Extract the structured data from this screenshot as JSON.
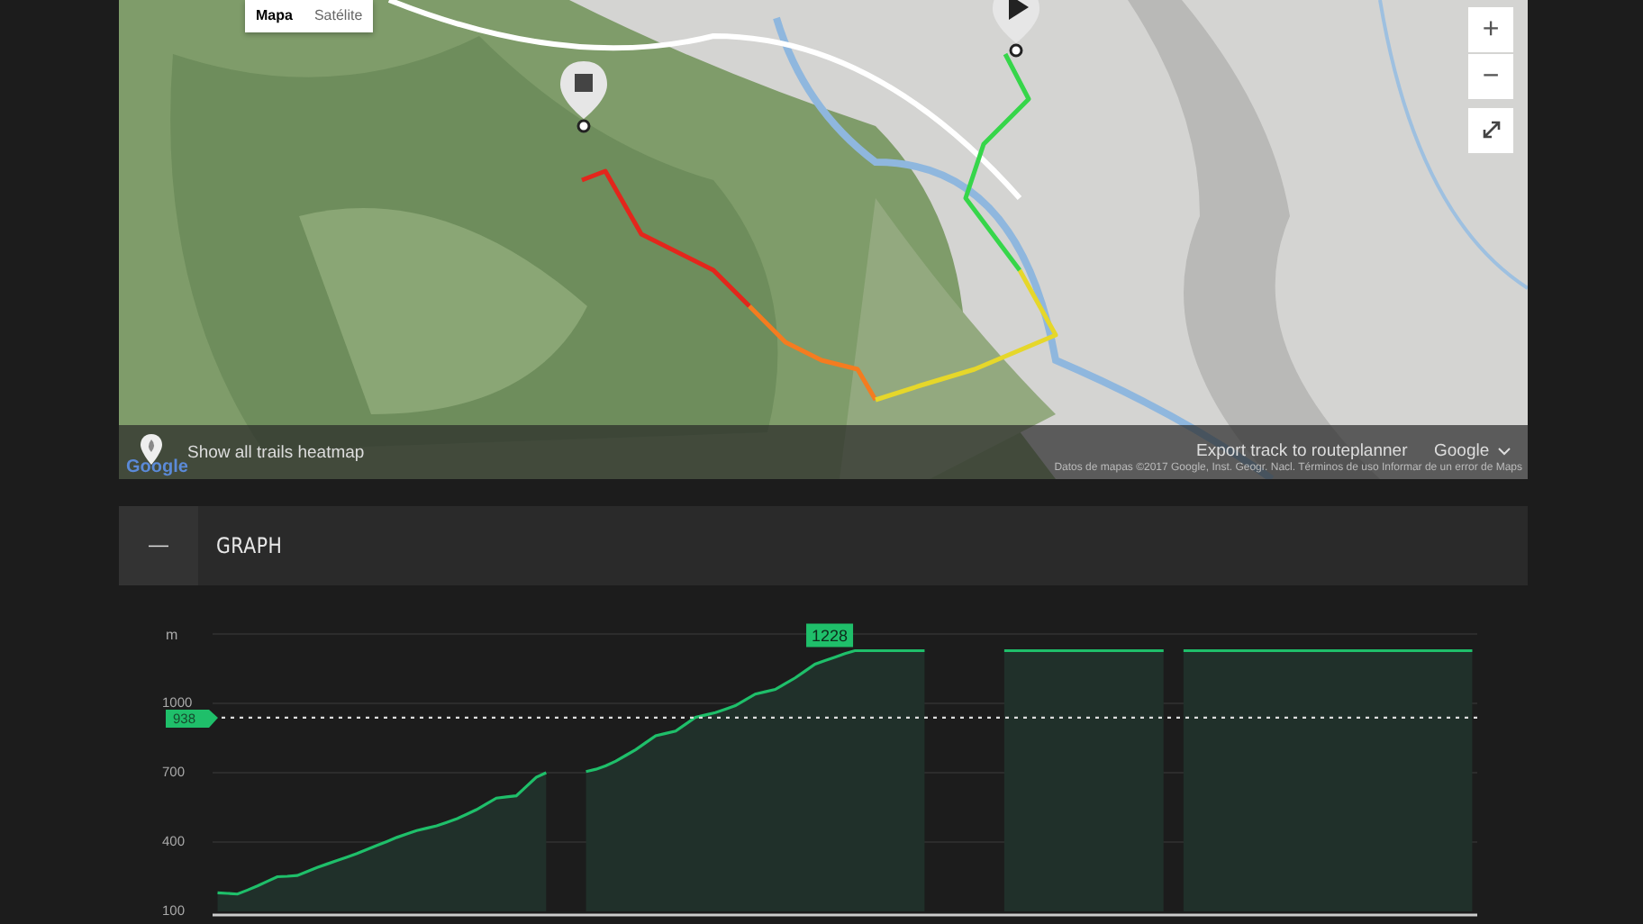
{
  "map": {
    "kind": "picture",
    "map_types": [
      {
        "label": "Mapa",
        "selected": true
      },
      {
        "label": "Satélite",
        "selected": false
      }
    ],
    "zoom_in": "+",
    "zoom_out": "−",
    "heatmap_toggle": "Show all trails heatmap",
    "logo": "Google",
    "export_link": "Export track to routeplanner",
    "language_select": "Google",
    "attribution": "Datos de mapas ©2017 Google, Inst. Geogr. Nacl. Términos de uso Informar de un error de Maps"
  },
  "graph": {
    "collapse_symbol": "—",
    "title": "GRAPH",
    "chart_data": {
      "type": "area",
      "ylabel": "m",
      "categories": [
        null,
        null,
        null,
        null,
        null,
        null,
        null,
        null,
        null,
        null,
        null,
        null,
        null,
        null,
        null,
        null,
        null,
        null,
        null,
        null,
        null,
        null,
        null,
        null,
        null,
        null,
        null,
        null,
        null,
        null,
        null,
        null,
        null,
        null,
        null,
        null,
        null,
        null,
        null,
        null,
        null,
        null,
        null,
        null,
        null,
        null,
        null,
        null,
        null,
        null,
        null,
        null,
        null,
        null,
        null,
        null,
        null,
        null,
        null,
        null,
        null,
        null,
        null,
        null,
        null,
        null,
        null,
        null,
        null,
        null,
        null,
        null,
        null,
        null,
        null,
        null,
        null,
        null,
        null,
        null,
        null,
        null,
        null,
        null,
        null,
        null,
        null,
        null,
        null,
        null,
        null,
        null,
        null,
        null,
        null,
        null,
        null,
        null,
        null,
        null,
        null,
        null,
        null,
        null,
        null,
        null,
        null,
        null,
        null,
        null,
        null,
        null,
        null,
        null,
        null,
        null,
        null,
        null,
        null,
        null,
        null,
        null,
        null,
        null,
        null,
        null,
        null
      ],
      "series": [
        {
          "color": "#1fbf6a",
          "values": [
            180,
            178,
            175,
            192,
            210,
            230,
            250,
            252,
            255,
            272,
            290,
            305,
            320,
            335,
            350,
            368,
            385,
            402,
            420,
            435,
            450,
            460,
            470,
            485,
            500,
            520,
            540,
            565,
            590,
            595,
            600,
            640,
            680,
            700,
            null,
            null,
            null,
            705,
            715,
            730,
            750,
            775,
            800,
            830,
            860,
            870,
            880,
            910,
            940,
            950,
            960,
            975,
            990,
            1015,
            1040,
            1050,
            1060,
            1085,
            1110,
            1140,
            1170,
            1185,
            1200,
            1215,
            1228,
            1228,
            1228,
            1228,
            1228,
            1228,
            1228,
            1228,
            null,
            null,
            null,
            null,
            null,
            null,
            null,
            1228,
            1228,
            1228,
            1228,
            1228,
            1228,
            1228,
            1228,
            1228,
            1228,
            1228,
            1228,
            1228,
            1228,
            1228,
            1228,
            1228,
            null,
            1228,
            1228,
            1228,
            1228,
            1228,
            1228,
            1228,
            1228,
            1228,
            1228,
            1228,
            1228,
            1228,
            1228,
            1228,
            1228,
            1228,
            1228,
            1228,
            1228,
            1228,
            1228,
            1228,
            1228,
            1228,
            1228,
            1228,
            1228,
            1228,
            1228
          ]
        }
      ],
      "ylim": [
        100,
        1300
      ],
      "yticks": [
        100,
        400,
        700,
        1000
      ],
      "grid": true,
      "ref_lines": [
        {
          "axis": "y",
          "value": 938,
          "label": "938"
        }
      ],
      "annotations": [
        {
          "y": 1228,
          "text": "1228"
        }
      ]
    }
  }
}
